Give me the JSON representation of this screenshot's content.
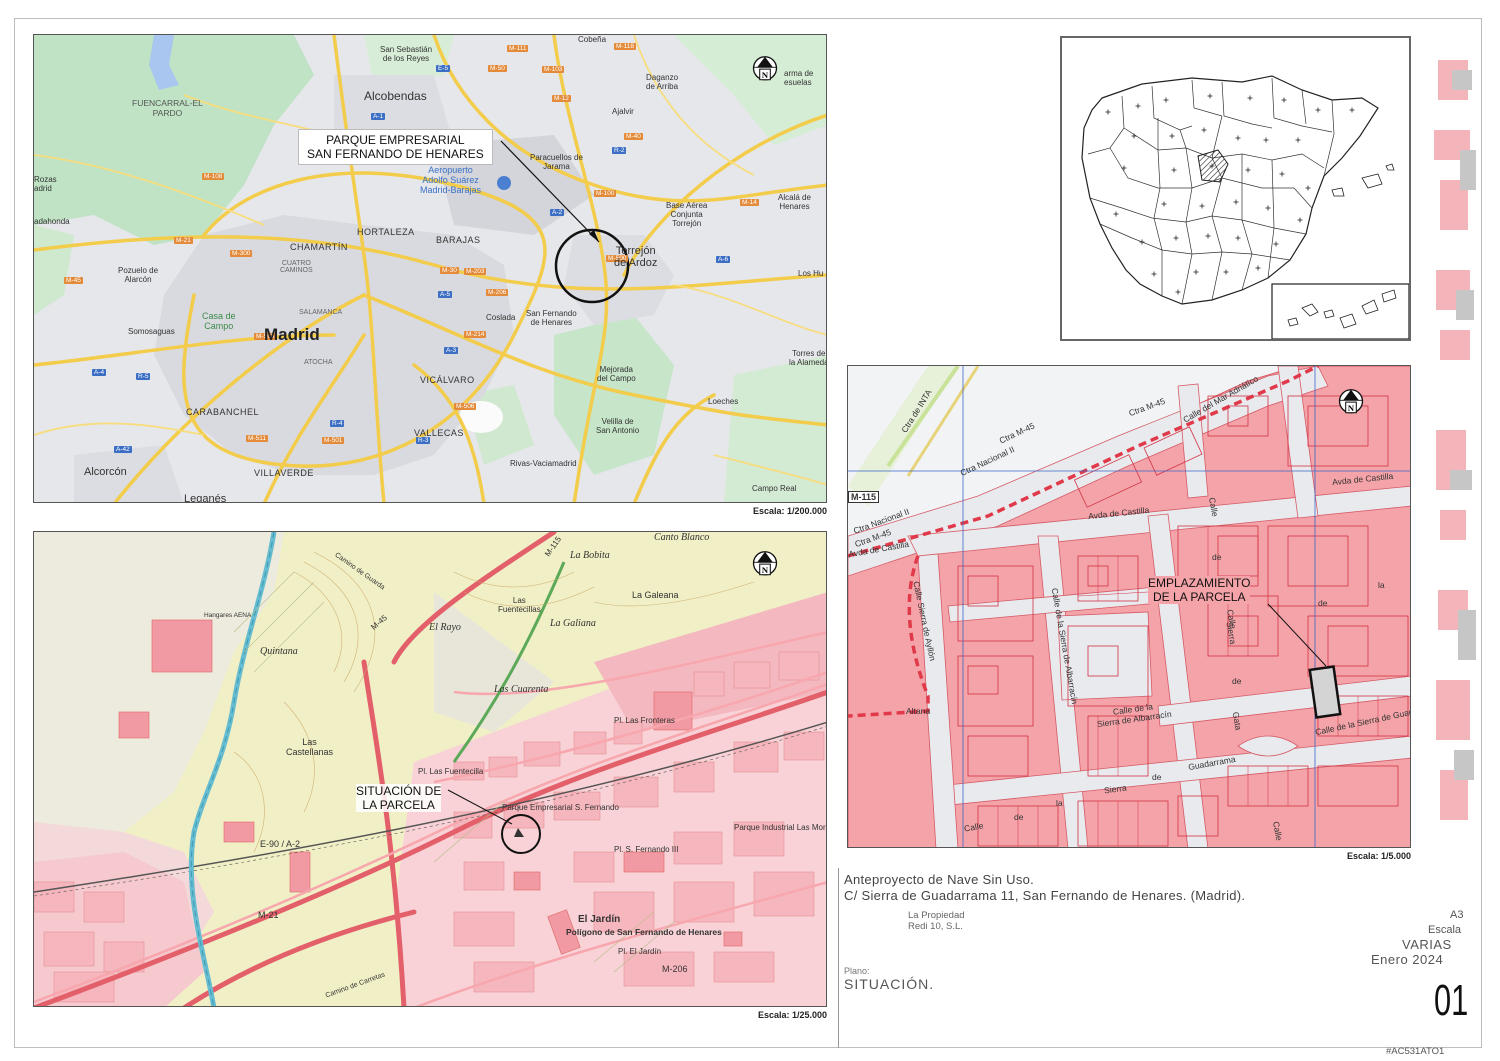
{
  "panels": {
    "overview": {
      "scale": "Escala: 1/200.000",
      "callout": [
        "PARQUE EMPRESARIAL",
        "SAN FERNANDO DE HENARES"
      ],
      "labels": {
        "fuencarral": [
          "FUENCARRAL-EL",
          "PARDO"
        ],
        "alcobendas": "Alcobendas",
        "sansebastian": [
          "San Sebastián",
          "de los Reyes"
        ],
        "madrid": "Madrid",
        "chamartin": "CHAMARTÍN",
        "hortaleza": "HORTALEZA",
        "barajas": "BARAJAS",
        "aeropuerto": [
          "Aeropuerto",
          "Adolfo Suárez",
          "Madrid-Barajas"
        ],
        "torrejon": [
          "Torrejón",
          "de Ardoz"
        ],
        "coslada": "Coslada",
        "sanfernando": [
          "San Fernando",
          "de Henares"
        ],
        "vicalvaro": "VICÁLVARO",
        "vallecas": "VALLECAS",
        "villaverde": "VILLAVERDE",
        "carabanchel": "CARABANCHEL",
        "alcorcon": "Alcorcón",
        "leganes": "Leganés",
        "pozuelo": [
          "Pozuelo de",
          "Alarcón"
        ],
        "somosaguas": "Somosaguas",
        "casadecampo": [
          "Casa de",
          "Campo"
        ],
        "cuatrocaminos": [
          "CUATRO",
          "CAMINOS"
        ],
        "salamanca": "SALAMANCA",
        "atocha": "ATOCHA",
        "mejorada": [
          "Mejorada",
          "del Campo"
        ],
        "velilla": [
          "Velilla de",
          "San Antonio"
        ],
        "rivas": "Rivas-Vaciamadrid",
        "loeches": "Loeches",
        "campoReal": "Campo Real",
        "paracuellos": [
          "Paracuellos de",
          "Jarama"
        ],
        "ajalvir": "Ajalvir",
        "daganzo": [
          "Daganzo",
          "de Arriba"
        ],
        "baseaerea": [
          "Base Aérea",
          "Conjunta",
          "Torrejón"
        ],
        "alcala": [
          "Alcalá de",
          "Henares"
        ],
        "torresalameda": [
          "Torres de",
          "la Alameda"
        ],
        "loshuertos": "Los Hu",
        "majadahonda": "adahonda",
        "rozas": [
          "Rozas",
          "adrid"
        ],
        "cobena": "Cobeña",
        "camarma": [
          "arma de",
          "esuelas"
        ]
      },
      "roads": [
        "M-111",
        "M-103",
        "M-118",
        "E-5",
        "M-50",
        "A-1",
        "M-12",
        "M-40",
        "M-603",
        "R-2",
        "M-108",
        "A-2",
        "M-100",
        "M-14",
        "M-21",
        "M-30",
        "M-203",
        "M-206",
        "M-300",
        "A-6",
        "M-500",
        "M-503",
        "M-214",
        "M-45",
        "A-3",
        "A-4",
        "A-5",
        "R-5",
        "M-511",
        "M-501",
        "M-506",
        "R-4",
        "A-42",
        "R-3"
      ]
    },
    "topo": {
      "scale": "Escala: 1/25.000",
      "callout": [
        "SITUACIÓN DE",
        "LA PARCELA"
      ],
      "labels": {
        "bobita": "La Bobita",
        "cantoBlanco": "Canto Blanco",
        "galeana": "La Galeana",
        "galiana": "La Galiana",
        "rayo": "El Rayo",
        "fuentecillas": [
          "Las",
          "Fuentecillas"
        ],
        "cuarenta": "Las Cuarenta",
        "quintana": "Quintana",
        "castellanos": [
          "Las",
          "Castellanas"
        ],
        "plfuentecilla": "Pl. Las Fuentecilla",
        "plfronteras": "Pl. Las Fronteras",
        "parqueEmp": "Parque Empresarial S. Fernando",
        "plsfernando": "Pl. S. Fernando III",
        "parqueInd": "Parque Industrial Las Moras",
        "jardin": "El Jardín",
        "poligono": "Polígono de San Fernando de Henares",
        "pljardin": "Pl. El Jardín",
        "e90": "E-90 / A-2",
        "m21": "M-21",
        "m206": "M-206",
        "m45": "M-45",
        "m115": "M-115",
        "aena": "Hangares AENA",
        "caminoPardo": "Camino de Guarda",
        "camCarretas": "Camino de Carretas"
      }
    },
    "parcel": {
      "scale": "Escala: 1/5.000",
      "callout": [
        "EMPLAZAMIENTO",
        "DE LA PARCELA"
      ],
      "labels": {
        "m115": "M-115",
        "ctraNacional1": "Ctra Nacional II",
        "ctraNacional2": "Ctra Nacional II",
        "ctraM45a": "Ctra M-45",
        "ctraM45b": "Ctra M-45",
        "ctraM45c": "Ctra M-45",
        "ctraInta": "Ctra de INTA",
        "avdaCastilla1": "Avda de Castilla",
        "avdaCastilla2": "Avda de Castilla",
        "avdaCastilla3": "Avda de Castilla",
        "calleMar": "Calle del Mar Adriático",
        "calleAyllon": "Calle Sierra de Ayllón",
        "calleAlbarracin1": "Calle de la Sierra de Albarracín",
        "calleAlbarracin2": [
          "Calle de la",
          "Sierra de Albarracín"
        ],
        "calleGuadarrama": "Calle de la Sierra de Guadarrama",
        "calleSierraGata": [
          "Calle",
          "de",
          "Sierra",
          "de",
          "Gata"
        ],
        "altana": "Altana",
        "bottomWords": [
          "Calle",
          "de",
          "la",
          "Sierra",
          "de",
          "Guadarrama"
        ],
        "rightWords": [
          "Calle",
          "de",
          "la",
          "de"
        ],
        "calleCut": "Calle",
        "calleBottomRight": "Calle"
      }
    },
    "spain": {}
  },
  "titleBlock": {
    "project": "Anteproyecto de Nave Sin Uso.",
    "address": "C/ Sierra de Guadarrama 11, San Fernando de Henares. (Madrid).",
    "ownerLabel": "La Propiedad",
    "ownerName": "Redi 10, S.L.",
    "sheetSize": "A3",
    "scaleLabel": "Escala",
    "scaleValue": "VARIAS",
    "date": "Enero 2024",
    "planLabel": "Plano:",
    "planName": "SITUACIÓN.",
    "sheetNumber": "01",
    "code": "#AC531ATO1"
  },
  "colors": {
    "urban": "#f4a3a3",
    "urbanFill": "#f8c8c8",
    "building": "#f59c9c",
    "mapGreen": "#bfe3c4",
    "mapGray": "#e3e4e8",
    "roadYellow": "#f2cc4a",
    "water": "#a9c6f0",
    "topoYellow": "#f1efc5"
  }
}
